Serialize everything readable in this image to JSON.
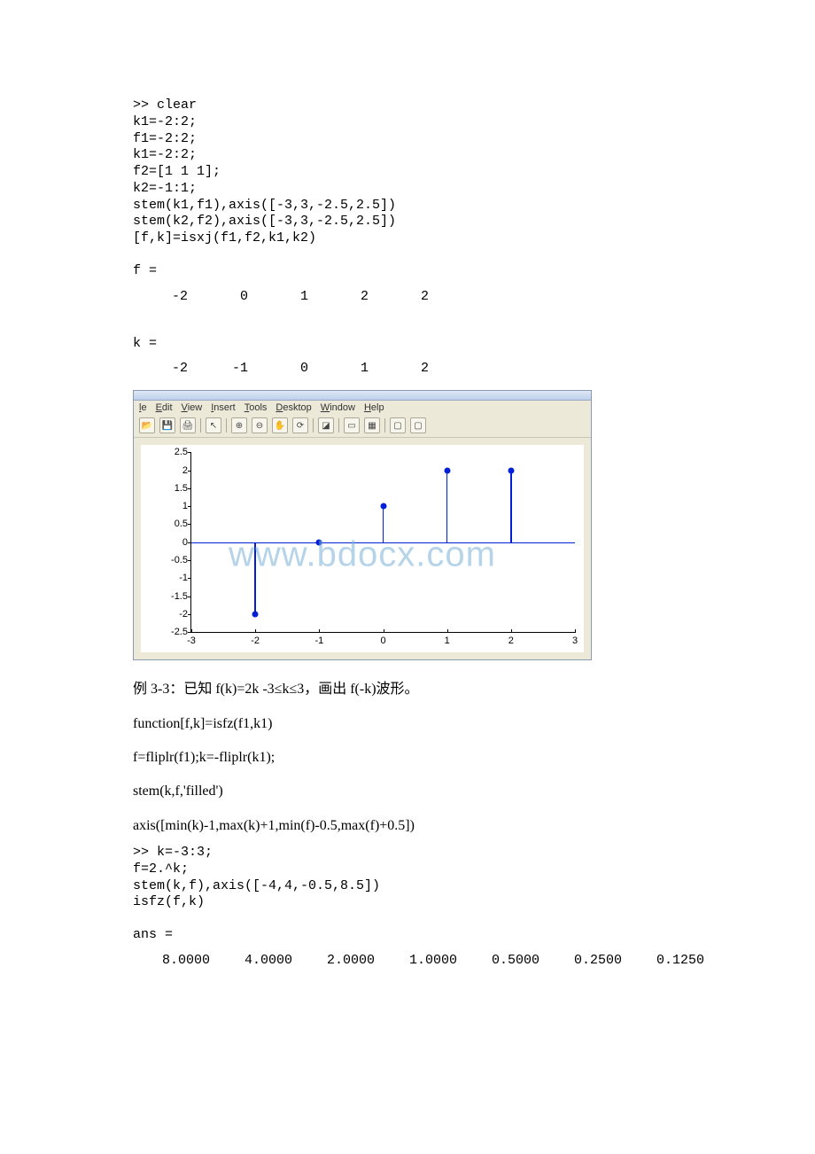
{
  "code1": ">> clear\nk1=-2:2;\nf1=-2:2;\nk1=-2:2;\nf2=[1 1 1];\nk2=-1:1;\nstem(k1,f1),axis([-3,3,-2.5,2.5])\nstem(k2,f2),axis([-3,3,-2.5,2.5])\n[f,k]=isxj(f1,f2,k1,k2)",
  "f_label": "f =",
  "f_values": [
    "-2",
    "0",
    "1",
    "2",
    "2"
  ],
  "k_label": "k =",
  "k_values": [
    "-2",
    "-1",
    "0",
    "1",
    "2"
  ],
  "menus": [
    "le",
    "Edit",
    "View",
    "Insert",
    "Tools",
    "Desktop",
    "Window",
    "Help"
  ],
  "watermark": "www.bdocx.com",
  "chart_data": {
    "type": "stem",
    "x": [
      -2,
      -1,
      0,
      1,
      2
    ],
    "y": [
      -2,
      0,
      1,
      2,
      2
    ],
    "xlim": [
      -3,
      3
    ],
    "ylim": [
      -2.5,
      2.5
    ],
    "xticks": [
      -3,
      -2,
      -1,
      0,
      1,
      2,
      3
    ],
    "yticks": [
      -2.5,
      -2,
      -1.5,
      -1,
      -0.5,
      0,
      0.5,
      1,
      1.5,
      2,
      2.5
    ]
  },
  "example_title": "例 3-3：已知 f(k)=2k -3≤k≤3，画出 f(-k)波形。",
  "func_def": "function[f,k]=isfz(f1,k1)",
  "func_body1": "f=fliplr(f1);k=-fliplr(k1);",
  "func_body2": "stem(k,f,'filled')",
  "func_body3": "axis([min(k)-1,max(k)+1,min(f)-0.5,max(f)+0.5])",
  "code2": ">> k=-3:3;\nf=2.^k;\nstem(k,f),axis([-4,4,-0.5,8.5])\nisfz(f,k)",
  "ans_label": "ans =",
  "ans_values": [
    "8.0000",
    "4.0000",
    "2.0000",
    "1.0000",
    "0.5000",
    "0.2500",
    "0.1250"
  ]
}
